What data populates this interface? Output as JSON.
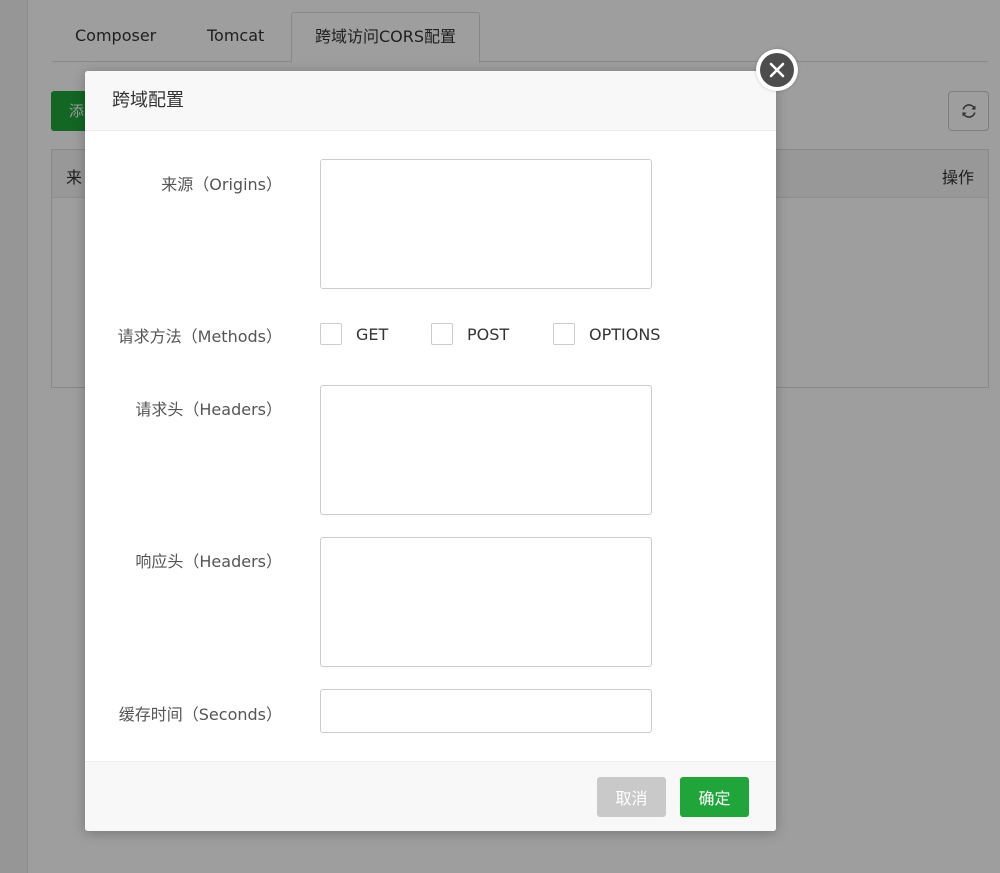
{
  "tabs": [
    {
      "label": "Composer"
    },
    {
      "label": "Tomcat"
    },
    {
      "label": "跨域访问CORS配置"
    }
  ],
  "toolbar": {
    "add_label": "添",
    "refresh_icon": "refresh-icon"
  },
  "table": {
    "columns": [
      "来",
      "操作"
    ]
  },
  "dialog": {
    "title": "跨域配置",
    "origins_label": "来源（Origins）",
    "origins_value": "",
    "methods_label": "请求方法（Methods）",
    "methods": [
      {
        "label": "GET",
        "checked": false
      },
      {
        "label": "POST",
        "checked": false
      },
      {
        "label": "OPTIONS",
        "checked": false
      }
    ],
    "request_headers_label": "请求头（Headers）",
    "request_headers_value": "",
    "response_headers_label": "响应头（Headers）",
    "response_headers_value": "",
    "cache_label": "缓存时间（Seconds）",
    "cache_value": "",
    "cancel_label": "取消",
    "confirm_label": "确定"
  },
  "colors": {
    "primary": "#20a53a",
    "cancel": "#c9c9c9",
    "close": "#4d4d4d"
  }
}
